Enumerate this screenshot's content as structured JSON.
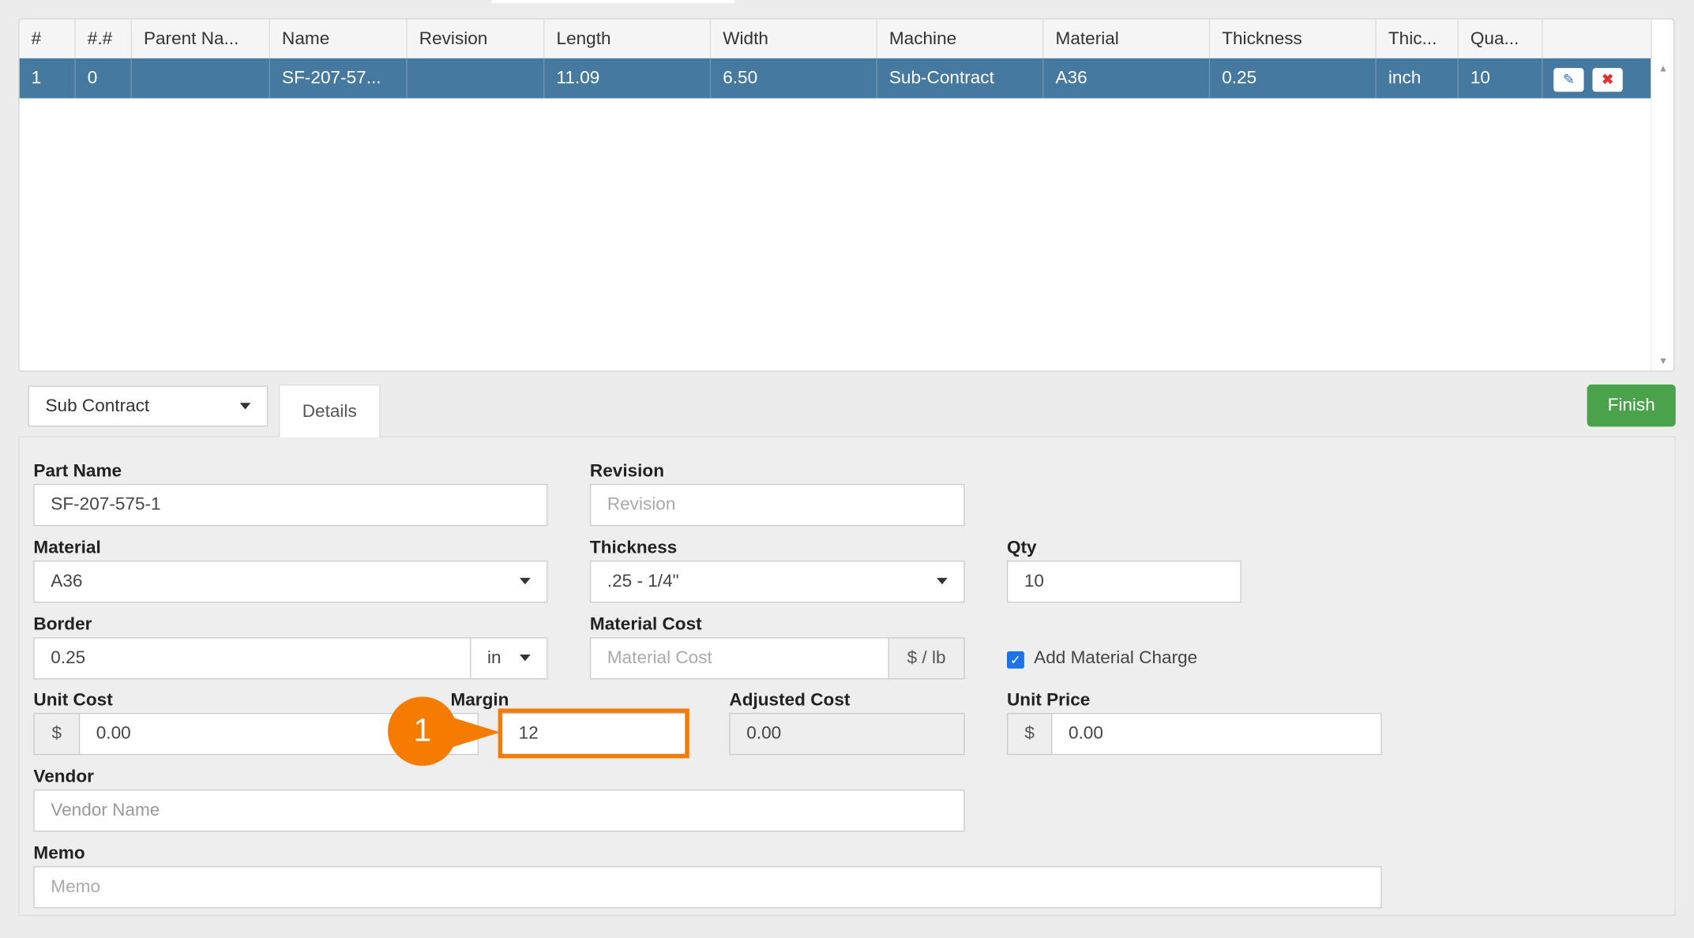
{
  "grid": {
    "columns": [
      "#",
      "#.#",
      "Parent Na...",
      "Name",
      "Revision",
      "Length",
      "Width",
      "Machine",
      "Material",
      "Thickness",
      "Thic...",
      "Qua...",
      ""
    ],
    "rows": [
      [
        "1",
        "0",
        "",
        "SF-207-57...",
        "",
        "11.09",
        "6.50",
        "Sub-Contract",
        "A36",
        "0.25",
        "inch",
        "10"
      ]
    ]
  },
  "toolbar": {
    "process_select": "Sub Contract",
    "details_tab": "Details",
    "finish_label": "Finish"
  },
  "form": {
    "part_name_label": "Part Name",
    "part_name": "SF-207-575-1",
    "revision_label": "Revision",
    "revision_placeholder": "Revision",
    "material_label": "Material",
    "material": "A36",
    "thickness_label": "Thickness",
    "thickness": ".25 - 1/4\"",
    "qty_label": "Qty",
    "qty": "10",
    "border_label": "Border",
    "border": "0.25",
    "border_unit": "in",
    "material_cost_label": "Material Cost",
    "material_cost_placeholder": "Material Cost",
    "material_cost_unit": "$ / lb",
    "add_material_charge": "Add Material Charge",
    "unit_cost_label": "Unit Cost",
    "unit_cost_prefix": "$",
    "unit_cost": "0.00",
    "margin_label": "Margin",
    "margin": "12",
    "adjusted_cost_label": "Adjusted Cost",
    "adjusted_cost": "0.00",
    "unit_price_label": "Unit Price",
    "unit_price_prefix": "$",
    "unit_price": "0.00",
    "vendor_label": "Vendor",
    "vendor_placeholder": "Vendor Name",
    "memo_label": "Memo",
    "memo_placeholder": "Memo"
  },
  "callout": {
    "step": "1",
    "color": "#f57c00"
  }
}
